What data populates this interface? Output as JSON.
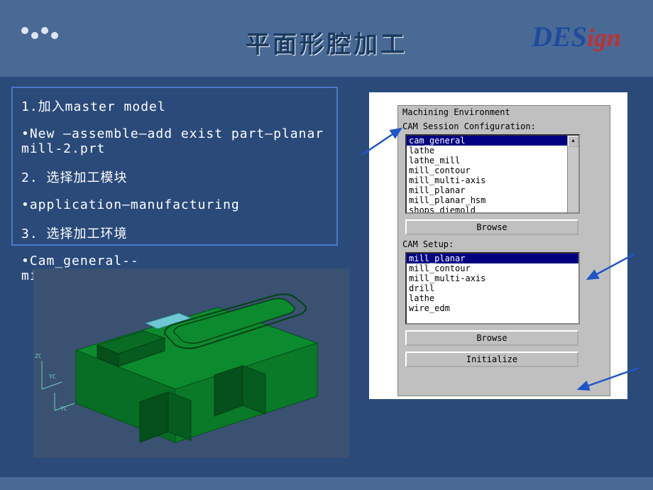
{
  "header": {
    "title": "平面形腔加工",
    "logo_des": "DES",
    "logo_ign": "ign"
  },
  "steps": {
    "s1_label": "1.加入master model",
    "s1_detail": "•New –assemble—add exist part—planar mill-2.prt",
    "s2_label": "2. 选择加工模块",
    "s2_detail": "•application—manufacturing",
    "s3_label": "3. 选择加工环境",
    "s3_detail": "•Cam_general--mill_planar――initialize"
  },
  "env": {
    "panel_title": "Machining Environment",
    "section1": "CAM Session Configuration:",
    "list1": {
      "items": [
        "cam_general",
        "lathe",
        "lathe_mill",
        "mill_contour",
        "mill_multi-axis",
        "mill_planar",
        "mill_planar_hsm",
        "shops_diemold"
      ],
      "selected": 0
    },
    "browse1": "Browse",
    "section2": "CAM Setup:",
    "list2": {
      "items": [
        "mill_planar",
        "mill_contour",
        "mill_multi-axis",
        "drill",
        "lathe",
        "wire_edm"
      ],
      "selected": 0
    },
    "browse2": "Browse",
    "initialize": "Initialize"
  },
  "viewport": {
    "axes": {
      "z": "ZC",
      "y1": "YC",
      "y2": "YC"
    }
  }
}
